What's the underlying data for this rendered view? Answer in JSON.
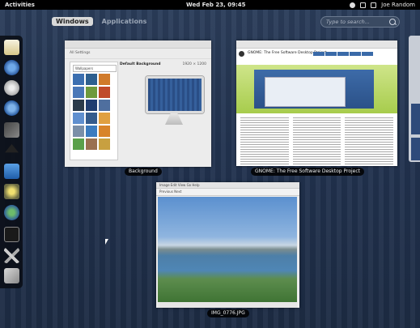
{
  "topbar": {
    "activities": "Activities",
    "clock": "Wed Feb 23, 09:45",
    "user": "Joe Random"
  },
  "view_selector": {
    "tabs": [
      {
        "label": "Windows",
        "active": true
      },
      {
        "label": "Applications",
        "active": false
      }
    ]
  },
  "search": {
    "placeholder": "Type to search..."
  },
  "dash": {
    "items": [
      "text-editor-icon",
      "browser-icon",
      "disk-icon",
      "mail-icon",
      "system-monitor-icon",
      "eject-icon",
      "image-viewer-icon",
      "disk-utility-icon",
      "network-icon",
      "terminal-icon",
      "tools-icon",
      "settings-icon"
    ]
  },
  "windows": [
    {
      "caption": "Background",
      "settings_title": "All Settings",
      "combo": "Wallpapers",
      "preview_label": "Default Background",
      "preview_size": "1920 × 1200"
    },
    {
      "caption": "GNOME: The Free Software Desktop Project",
      "page_title": "GNOME: The Free Software Desktop Project"
    },
    {
      "caption": "IMG_0776.JPG",
      "menu": "Image  Edit  View  Go  Help",
      "toolbar": "Previous  Next"
    }
  ],
  "colors": {
    "panel": "#000000",
    "overview_bg": "#223350",
    "tab_active_bg": "#d9d9d9"
  }
}
